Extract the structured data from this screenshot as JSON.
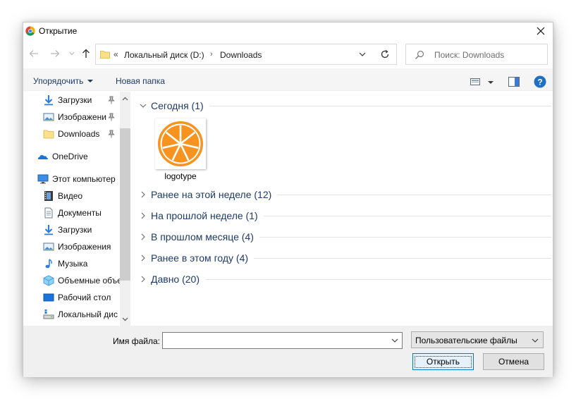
{
  "window": {
    "title": "Открытие",
    "close_glyph": "✕"
  },
  "address": {
    "overflow": "«",
    "segments": [
      "Локальный диск (D:)",
      "Downloads"
    ],
    "separator": "›"
  },
  "search": {
    "placeholder": "Поиск: Downloads"
  },
  "toolbar": {
    "organize_label": "Упорядочить",
    "new_folder_label": "Новая папка",
    "help_glyph": "?"
  },
  "sidebar": {
    "items": [
      {
        "label": "Загрузки",
        "icon": "download-arrow-icon",
        "pinned": true
      },
      {
        "label": "Изображени",
        "icon": "pictures-icon",
        "pinned": true
      },
      {
        "label": "Downloads",
        "icon": "folder-icon",
        "pinned": true
      },
      {
        "label": "OneDrive",
        "icon": "onedrive-cloud-icon",
        "pinned": false
      },
      {
        "label": "Этот компьютер",
        "icon": "computer-icon",
        "pinned": false
      },
      {
        "label": "Видео",
        "icon": "video-icon",
        "pinned": false
      },
      {
        "label": "Документы",
        "icon": "documents-icon",
        "pinned": false
      },
      {
        "label": "Загрузки",
        "icon": "download-arrow-icon",
        "pinned": false
      },
      {
        "label": "Изображения",
        "icon": "pictures-icon",
        "pinned": false
      },
      {
        "label": "Музыка",
        "icon": "music-icon",
        "pinned": false
      },
      {
        "label": "Объемные объе",
        "icon": "3d-objects-icon",
        "pinned": false
      },
      {
        "label": "Рабочий стол",
        "icon": "desktop-icon",
        "pinned": false
      },
      {
        "label": "Локальный дис",
        "icon": "drive-icon",
        "pinned": false
      }
    ]
  },
  "groups": [
    {
      "label": "Сегодня (1)",
      "expanded": true
    },
    {
      "label": "Ранее на этой неделе (12)",
      "expanded": false
    },
    {
      "label": "На прошлой неделе (1)",
      "expanded": false
    },
    {
      "label": "В прошлом месяце (4)",
      "expanded": false
    },
    {
      "label": "Ранее в этом году (4)",
      "expanded": false
    },
    {
      "label": "Давно (20)",
      "expanded": false
    }
  ],
  "files": [
    {
      "name": "logotype",
      "icon": "orange-slice-icon"
    }
  ],
  "footer": {
    "filename_label": "Имя файла:",
    "filename_value": "",
    "filter_value": "Пользовательские файлы",
    "open_label": "Открыть",
    "cancel_label": "Отмена"
  },
  "colors": {
    "link_text": "#1e3a66",
    "accent": "#0078d7",
    "orange": "#f7931e"
  }
}
